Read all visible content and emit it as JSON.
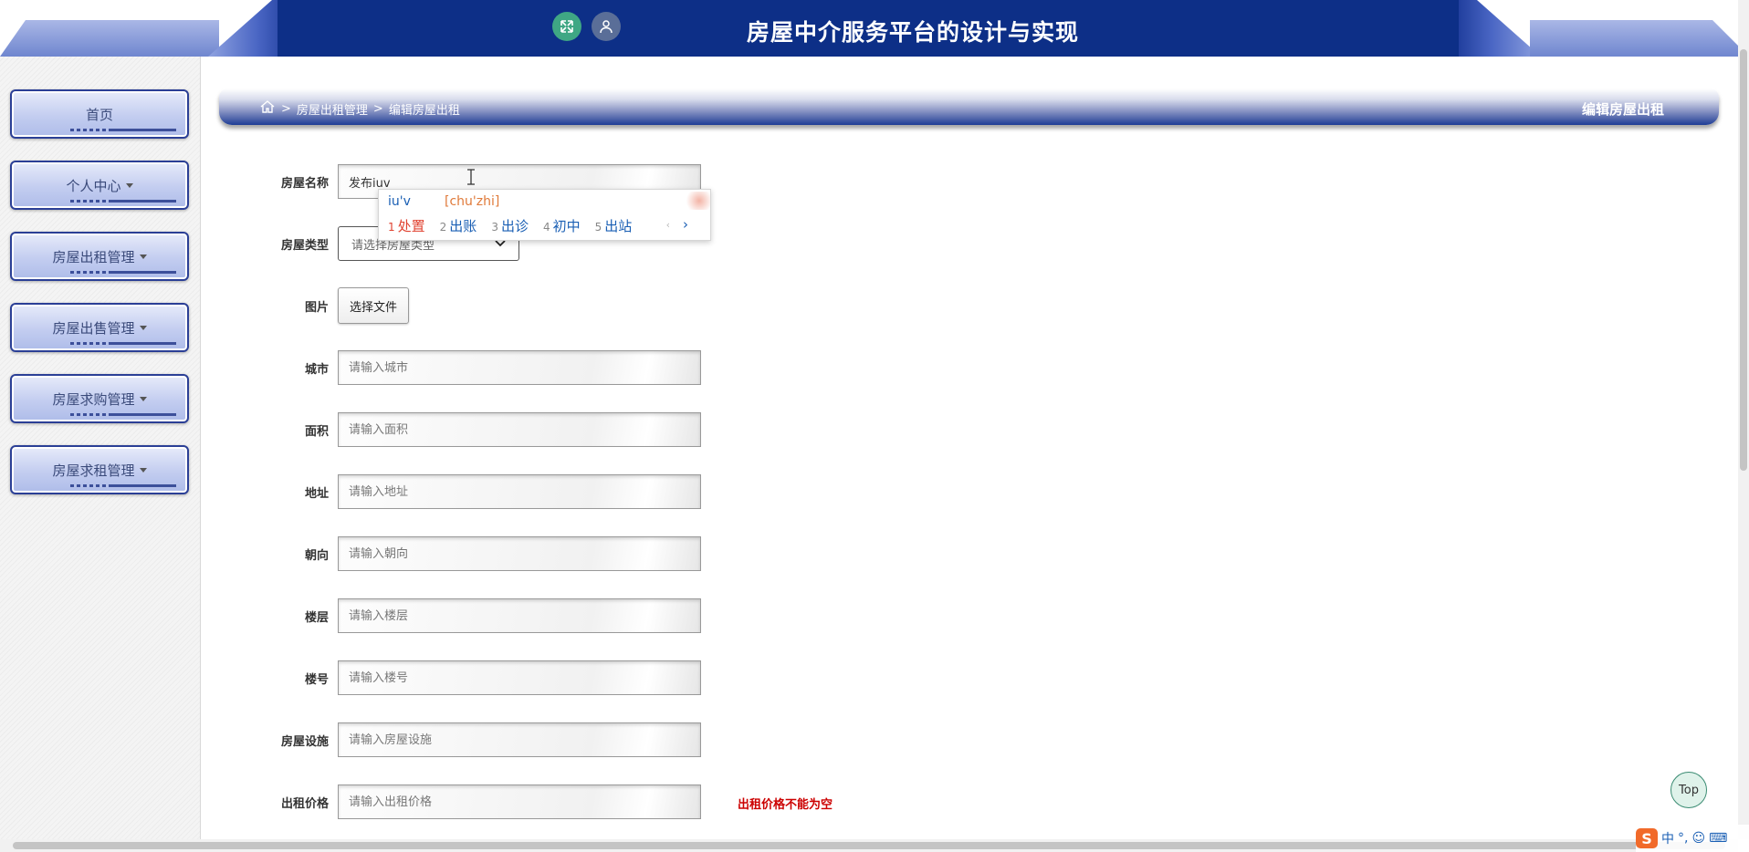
{
  "header": {
    "title": "房屋中介服务平台的设计与实现",
    "expand_icon": "expand-arrows-icon",
    "user_icon": "user-icon"
  },
  "sidebar": {
    "items": [
      {
        "label": "首页"
      },
      {
        "label": "个人中心"
      },
      {
        "label": "房屋出租管理"
      },
      {
        "label": "房屋出售管理"
      },
      {
        "label": "房屋求购管理"
      },
      {
        "label": "房屋求租管理"
      }
    ]
  },
  "breadcrumb": {
    "home_icon": "home-icon",
    "separator": ">",
    "level1": "房屋出租管理",
    "level2": "编辑房屋出租",
    "page_title": "编辑房屋出租"
  },
  "form": {
    "name": {
      "label": "房屋名称",
      "value": "发布iuv"
    },
    "type": {
      "label": "房屋类型",
      "placeholder": "请选择房屋类型"
    },
    "image": {
      "label": "图片",
      "button": "选择文件"
    },
    "city": {
      "label": "城市",
      "placeholder": "请输入城市"
    },
    "area": {
      "label": "面积",
      "placeholder": "请输入面积"
    },
    "address": {
      "label": "地址",
      "placeholder": "请输入地址"
    },
    "orientation": {
      "label": "朝向",
      "placeholder": "请输入朝向"
    },
    "floor": {
      "label": "楼层",
      "placeholder": "请输入楼层"
    },
    "building_no": {
      "label": "楼号",
      "placeholder": "请输入楼号"
    },
    "facilities": {
      "label": "房屋设施",
      "placeholder": "请输入房屋设施"
    },
    "rent_price": {
      "label": "出租价格",
      "placeholder": "请输入出租价格",
      "error": "出租价格不能为空"
    }
  },
  "ime_popup": {
    "composition": "iu'v",
    "pinyin": "[chu'zhi]",
    "candidates": [
      {
        "num": "1",
        "text": "处置"
      },
      {
        "num": "2",
        "text": "出账"
      },
      {
        "num": "3",
        "text": "出诊"
      },
      {
        "num": "4",
        "text": "初中"
      },
      {
        "num": "5",
        "text": "出站"
      }
    ],
    "more": "›"
  },
  "top_button": "Top",
  "ime_tray": {
    "logo": "S",
    "lang": "中",
    "punct": "°,",
    "emoji_icon": "smiley-icon",
    "keyboard_icon": "keyboard-icon"
  },
  "colors": {
    "header_bg": "#0d2f87",
    "menu_border": "#2b3f96",
    "error": "#cc0000",
    "ime_active": "#e0412f"
  }
}
